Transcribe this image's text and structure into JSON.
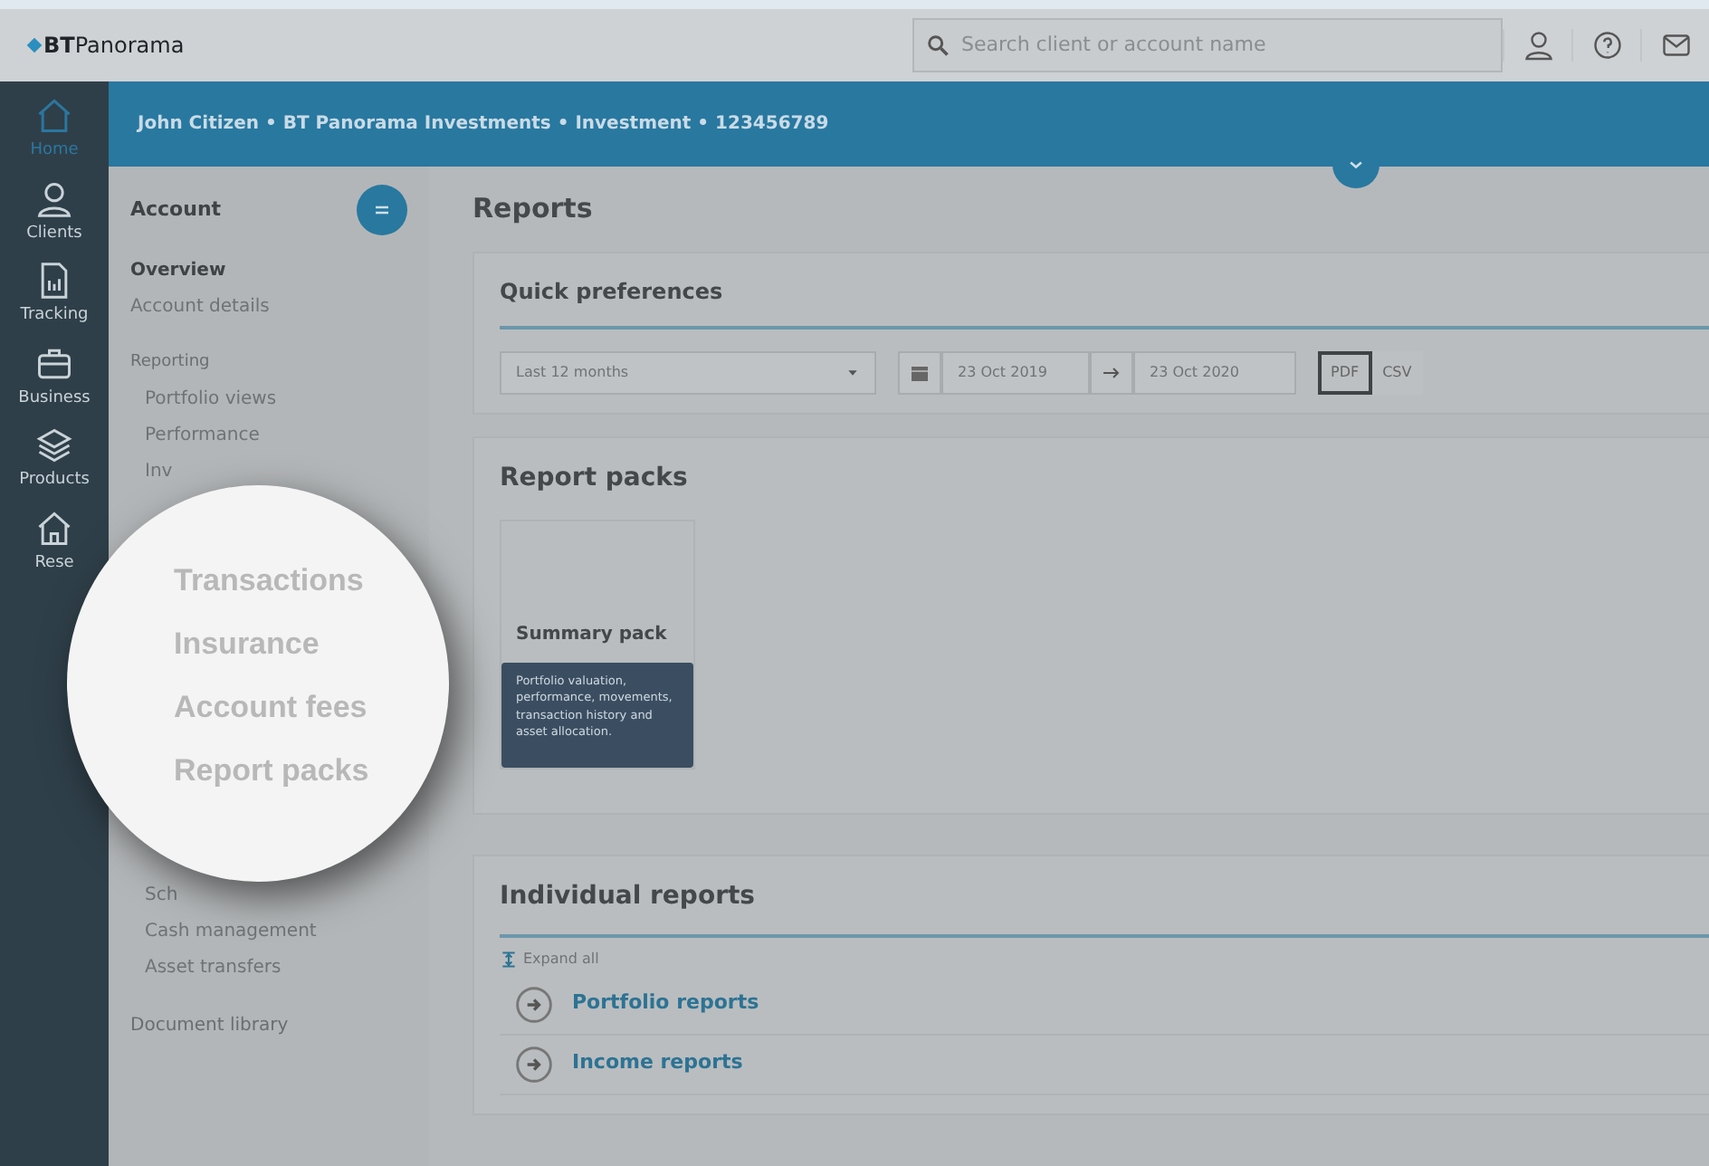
{
  "header": {
    "logo": "**BT**Panorama",
    "search": {
      "placeholder": "Search client or account name"
    }
  },
  "rail": [
    {
      "label": "Home",
      "selected": true
    },
    {
      "label": "Clients",
      "selected": false
    },
    {
      "label": "Tracking",
      "selected": false
    },
    {
      "label": "Business",
      "selected": false
    },
    {
      "label": "Products",
      "selected": false
    },
    {
      "label": "Rese",
      "selected": false
    }
  ],
  "banner": "John Citizen • BT Panorama Investments • Investment • 123456789",
  "account_menu": {
    "title": "Account",
    "sections": [
      {
        "heading": "Overview",
        "kind": "major",
        "items": [
          "Account details"
        ]
      },
      {
        "heading": "Reporting",
        "kind": "minor",
        "items": [
          "Portfolio views",
          "Performance",
          "Inv"
        ],
        "items_after": [
          "Sch",
          "Cash management",
          "Asset transfers"
        ]
      },
      {
        "heading": "Document library",
        "kind": "plain"
      }
    ]
  },
  "magnifier": {
    "items": [
      "Transactions",
      "Insurance",
      "Account fees",
      "Report packs"
    ]
  },
  "page_title": "Reports",
  "quick_preferences": {
    "title": "Quick preferences",
    "period": "Last 12 months",
    "date_from": "23 Oct 2019",
    "date_to": "23 Oct 2020",
    "formats": [
      {
        "label": "PDF",
        "selected": true
      },
      {
        "label": "CSV",
        "selected": false
      }
    ]
  },
  "report_packs": {
    "title": "Report packs",
    "packs": [
      {
        "title": "Summary pack",
        "description": "Portfolio valuation, performance, movements, transaction history and asset allocation."
      }
    ]
  },
  "individual_reports": {
    "title": "Individual reports",
    "expand": "Expand all",
    "items": [
      "Portfolio reports",
      "Income reports"
    ]
  }
}
